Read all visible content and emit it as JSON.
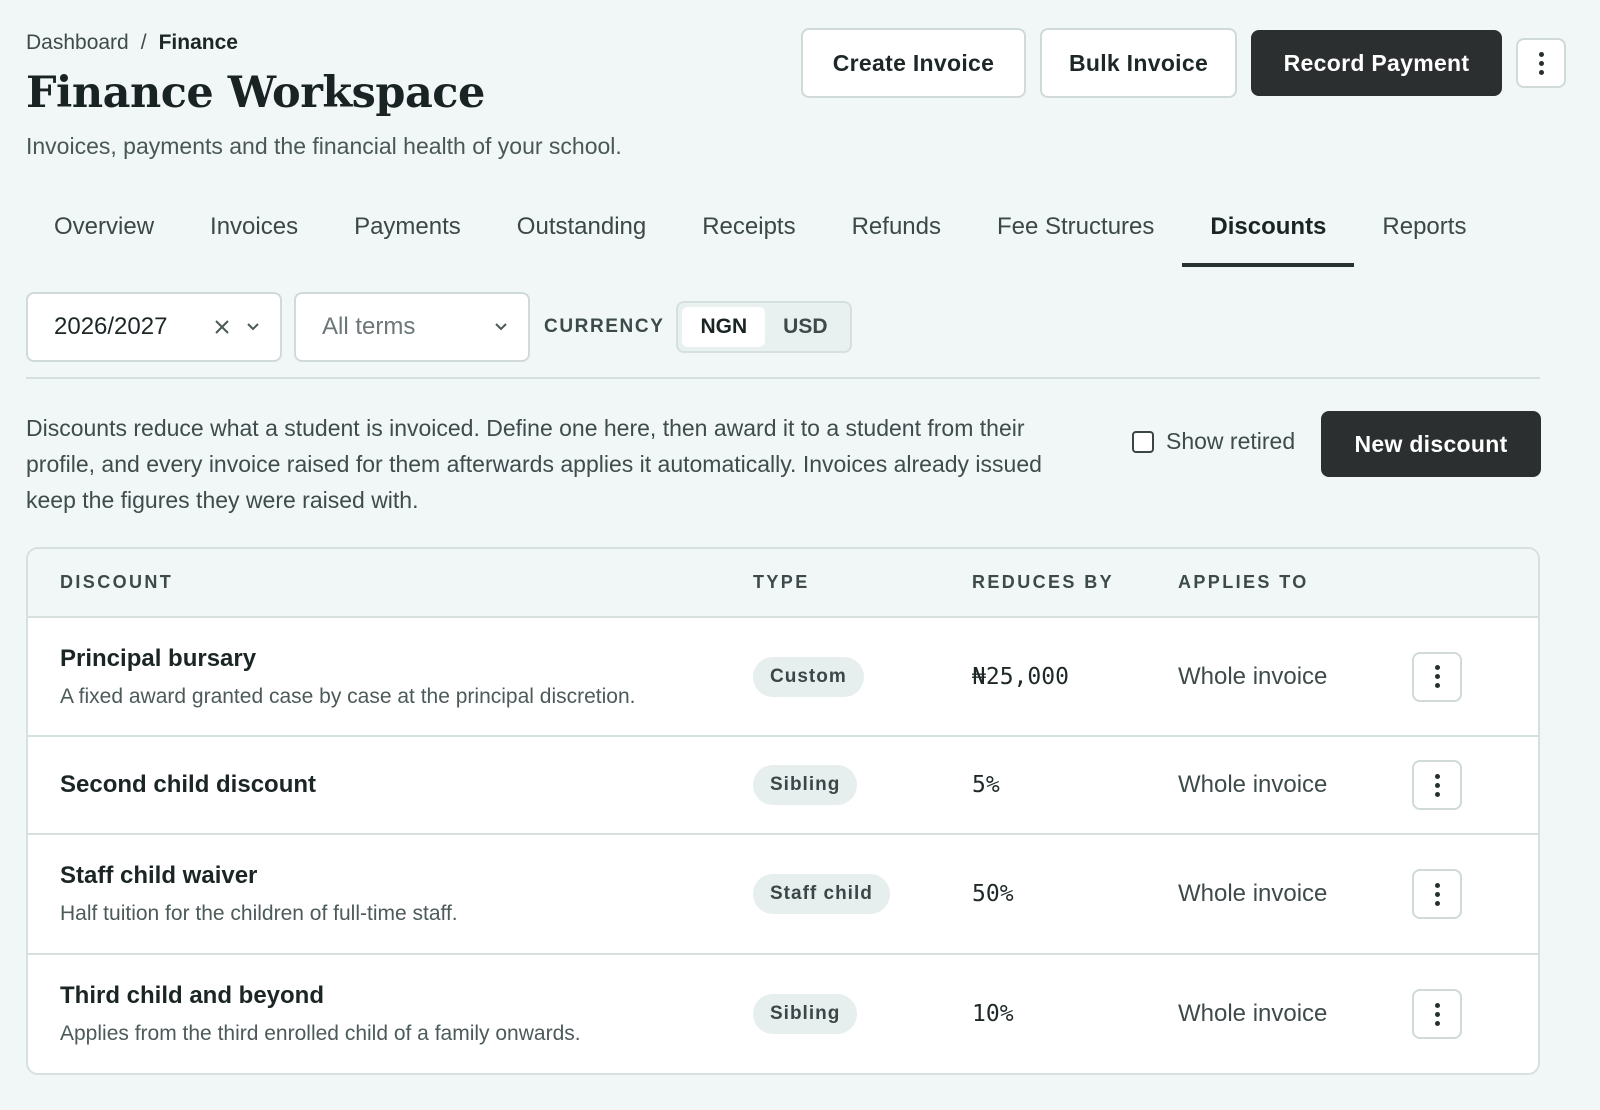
{
  "breadcrumb": {
    "root": "Dashboard",
    "separator": "/",
    "current": "Finance"
  },
  "page": {
    "title": "Finance Workspace",
    "subtitle": "Invoices, payments and the financial health of your school."
  },
  "actions": {
    "create_invoice": "Create Invoice",
    "bulk_invoice": "Bulk Invoice",
    "record_payment": "Record Payment",
    "more_icon": "more-vertical-icon"
  },
  "tabs": [
    {
      "label": "Overview",
      "active": false
    },
    {
      "label": "Invoices",
      "active": false
    },
    {
      "label": "Payments",
      "active": false
    },
    {
      "label": "Outstanding",
      "active": false
    },
    {
      "label": "Receipts",
      "active": false
    },
    {
      "label": "Refunds",
      "active": false
    },
    {
      "label": "Fee Structures",
      "active": false
    },
    {
      "label": "Discounts",
      "active": true
    },
    {
      "label": "Reports",
      "active": false
    }
  ],
  "filters": {
    "session": {
      "value": "2026/2027",
      "clear_icon": "close-icon",
      "dropdown_icon": "chevron-down-icon"
    },
    "term": {
      "placeholder": "All terms",
      "dropdown_icon": "chevron-down-icon"
    },
    "currency_label": "CURRENCY",
    "currencies": [
      {
        "label": "NGN",
        "selected": true
      },
      {
        "label": "USD",
        "selected": false
      }
    ]
  },
  "intro": {
    "text": "Discounts reduce what a student is invoiced. Define one here, then award it to a student from their profile, and every invoice raised for them afterwards applies it automatically. Invoices already issued keep the figures they were raised with.",
    "show_retired_label": "Show retired",
    "show_retired_checked": false,
    "new_discount_label": "New discount"
  },
  "table": {
    "headers": {
      "discount": "DISCOUNT",
      "type": "TYPE",
      "reduces_by": "REDUCES BY",
      "applies_to": "APPLIES TO"
    },
    "rows": [
      {
        "name": "Principal bursary",
        "description": "A fixed award granted case by case at the principal discretion.",
        "type": "Custom",
        "reduces_by": "₦25,000",
        "applies_to": "Whole invoice"
      },
      {
        "name": "Second child discount",
        "description": "",
        "type": "Sibling",
        "reduces_by": "5%",
        "applies_to": "Whole invoice"
      },
      {
        "name": "Staff child waiver",
        "description": "Half tuition for the children of full-time staff.",
        "type": "Staff child",
        "reduces_by": "50%",
        "applies_to": "Whole invoice"
      },
      {
        "name": "Third child and beyond",
        "description": "Applies from the third enrolled child of a family onwards.",
        "type": "Sibling",
        "reduces_by": "10%",
        "applies_to": "Whole invoice"
      }
    ]
  },
  "colors": {
    "dark_button": "#2b2f2f",
    "background": "#f1f6f6",
    "border": "#cfdad9"
  }
}
